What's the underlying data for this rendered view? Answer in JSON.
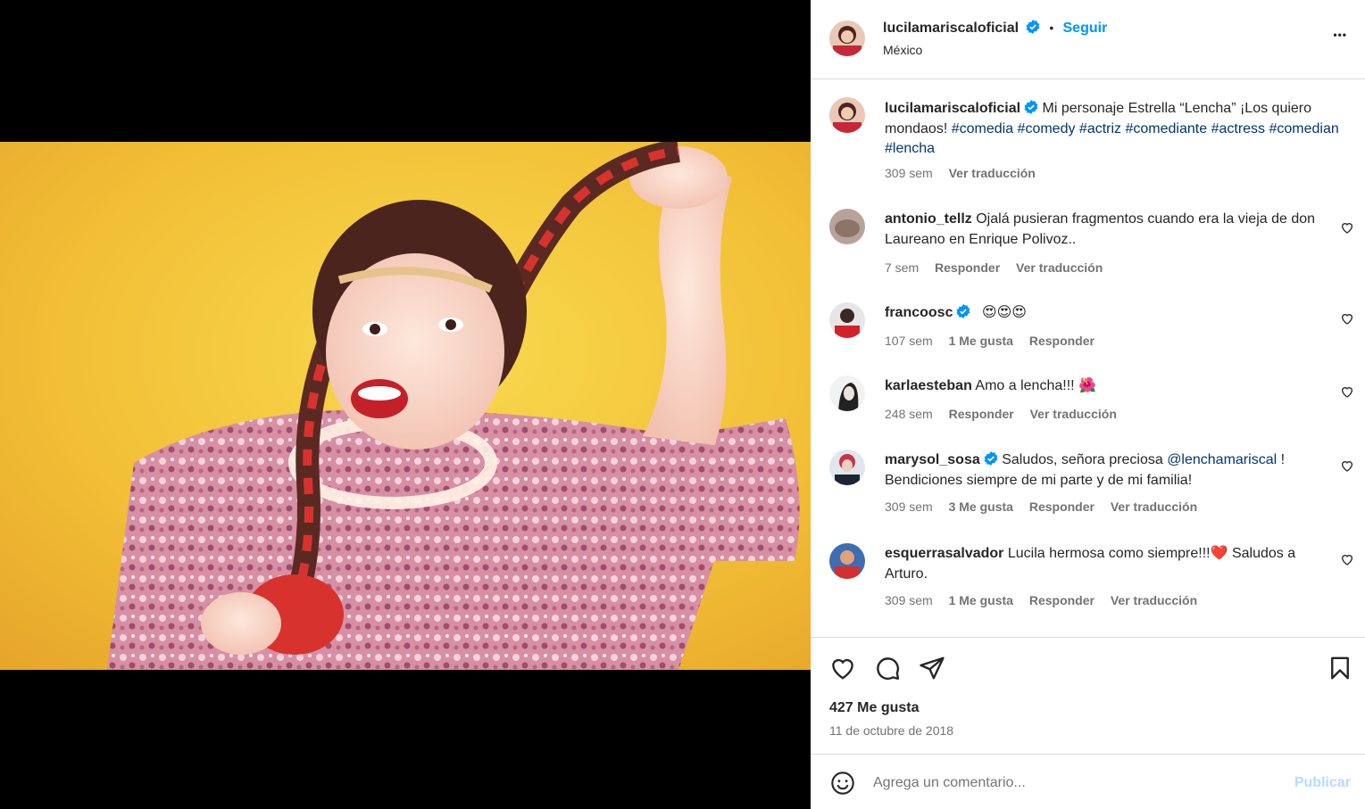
{
  "post": {
    "author": "lucilamariscaloficial",
    "follow_label": "Seguir",
    "dot": "•",
    "location": "México",
    "more_label": "•••"
  },
  "caption": {
    "username": "lucilamariscaloficial",
    "text": "Mi personaje Estrella “Lencha” ¡Los quiero mondaos!",
    "hashtags": [
      "#comedia",
      "#comedy",
      "#actriz",
      "#comediante",
      "#actress",
      "#comedian",
      "#lencha"
    ],
    "time": "309 sem",
    "translate": "Ver traducción"
  },
  "comments": [
    {
      "username": "antonio_tellz",
      "text": "Ojalá pusieran fragmentos cuando era la vieja de don Laureano en Enrique Polivoz..",
      "time": "7 sem",
      "likes": "",
      "reply": "Responder",
      "translate": "Ver traducción"
    },
    {
      "username": "francoosc",
      "text": "😍😍😍",
      "time": "107 sem",
      "likes": "1 Me gusta",
      "reply": "Responder",
      "translate": ""
    },
    {
      "username": "karlaesteban",
      "text": "Amo a lencha!!! 🌺",
      "time": "248 sem",
      "likes": "",
      "reply": "Responder",
      "translate": "Ver traducción"
    },
    {
      "username": "marysol_sosa",
      "text_before": "Saludos, señora preciosa ",
      "mention": "@lenchamariscal",
      "text_after": " ! Bendiciones siempre de mi parte y de mi familia!",
      "time": "309 sem",
      "likes": "3 Me gusta",
      "reply": "Responder",
      "translate": "Ver traducción"
    },
    {
      "username": "esquerrasalvador",
      "text": "Lucila hermosa como siempre!!!❤️ Saludos a Arturo.",
      "time": "309 sem",
      "likes": "1 Me gusta",
      "reply": "Responder",
      "translate": "Ver traducción"
    }
  ],
  "stats": {
    "likes": "427 Me gusta",
    "date": "11 de octubre de 2018"
  },
  "add_comment": {
    "placeholder": "Agrega un comentario...",
    "publish": "Publicar"
  },
  "colors": {
    "link": "#0095f6",
    "hashtag": "#00376b",
    "secondary": "#737373",
    "publish_disabled": "#b3dbff",
    "verified": "#0095f6"
  },
  "icons": [
    "like-icon",
    "comment-icon",
    "share-icon",
    "save-icon",
    "emoji-icon",
    "more-icon",
    "verified-badge-icon"
  ]
}
